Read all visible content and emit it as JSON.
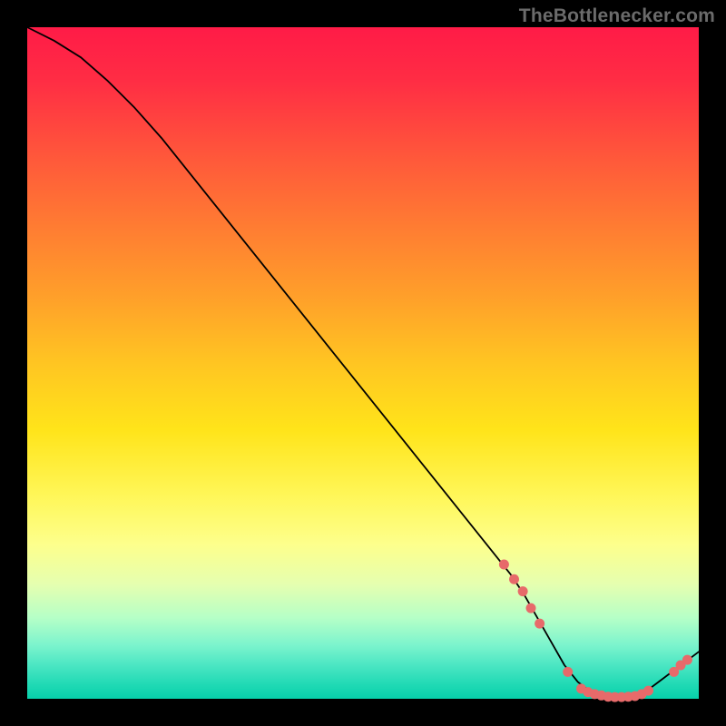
{
  "watermark": "TheBottlenecker.com",
  "colors": {
    "curve": "#000000",
    "dot": "#e76a6a"
  },
  "chart_data": {
    "type": "line",
    "title": "",
    "xlabel": "",
    "ylabel": "",
    "xlim": [
      0,
      100
    ],
    "ylim": [
      0,
      100
    ],
    "grid": false,
    "legend": false,
    "series": [
      {
        "name": "bottleneck-curve",
        "x": [
          0,
          4,
          8,
          12,
          16,
          20,
          24,
          28,
          32,
          36,
          40,
          44,
          48,
          52,
          56,
          60,
          64,
          68,
          72,
          74,
          76,
          78,
          80,
          82,
          84,
          86,
          88,
          90,
          92,
          94,
          96,
          98,
          100
        ],
        "values": [
          100,
          98,
          95.5,
          92,
          88,
          83.5,
          78.5,
          73.5,
          68.5,
          63.5,
          58.5,
          53.5,
          48.5,
          43.5,
          38.5,
          33.5,
          28.5,
          23.5,
          18.5,
          15.5,
          12,
          8.5,
          5,
          2.5,
          1,
          0.3,
          0.2,
          0.3,
          1,
          2.5,
          4,
          5.5,
          7
        ]
      }
    ],
    "points": [
      {
        "x": 71.0,
        "y": 20.0
      },
      {
        "x": 72.5,
        "y": 17.8
      },
      {
        "x": 73.8,
        "y": 16.0
      },
      {
        "x": 75.0,
        "y": 13.5
      },
      {
        "x": 76.3,
        "y": 11.2
      },
      {
        "x": 80.5,
        "y": 4.0
      },
      {
        "x": 82.5,
        "y": 1.5
      },
      {
        "x": 83.5,
        "y": 1.0
      },
      {
        "x": 84.5,
        "y": 0.7
      },
      {
        "x": 85.5,
        "y": 0.5
      },
      {
        "x": 86.5,
        "y": 0.3
      },
      {
        "x": 87.5,
        "y": 0.25
      },
      {
        "x": 88.5,
        "y": 0.25
      },
      {
        "x": 89.5,
        "y": 0.3
      },
      {
        "x": 90.5,
        "y": 0.4
      },
      {
        "x": 91.5,
        "y": 0.7
      },
      {
        "x": 92.5,
        "y": 1.2
      },
      {
        "x": 96.3,
        "y": 4.0
      },
      {
        "x": 97.3,
        "y": 5.0
      },
      {
        "x": 98.3,
        "y": 5.8
      }
    ]
  }
}
